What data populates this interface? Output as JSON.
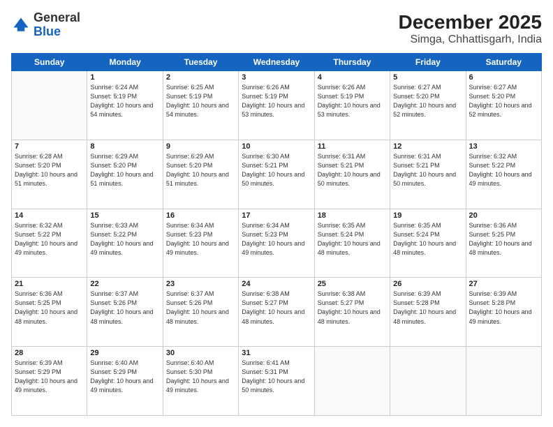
{
  "header": {
    "logo": {
      "general": "General",
      "blue": "Blue"
    },
    "title": "December 2025",
    "location": "Simga, Chhattisgarh, India"
  },
  "days_of_week": [
    "Sunday",
    "Monday",
    "Tuesday",
    "Wednesday",
    "Thursday",
    "Friday",
    "Saturday"
  ],
  "weeks": [
    [
      {
        "day": "",
        "empty": true
      },
      {
        "day": "1",
        "sunrise": "Sunrise: 6:24 AM",
        "sunset": "Sunset: 5:19 PM",
        "daylight": "Daylight: 10 hours and 54 minutes."
      },
      {
        "day": "2",
        "sunrise": "Sunrise: 6:25 AM",
        "sunset": "Sunset: 5:19 PM",
        "daylight": "Daylight: 10 hours and 54 minutes."
      },
      {
        "day": "3",
        "sunrise": "Sunrise: 6:26 AM",
        "sunset": "Sunset: 5:19 PM",
        "daylight": "Daylight: 10 hours and 53 minutes."
      },
      {
        "day": "4",
        "sunrise": "Sunrise: 6:26 AM",
        "sunset": "Sunset: 5:19 PM",
        "daylight": "Daylight: 10 hours and 53 minutes."
      },
      {
        "day": "5",
        "sunrise": "Sunrise: 6:27 AM",
        "sunset": "Sunset: 5:20 PM",
        "daylight": "Daylight: 10 hours and 52 minutes."
      },
      {
        "day": "6",
        "sunrise": "Sunrise: 6:27 AM",
        "sunset": "Sunset: 5:20 PM",
        "daylight": "Daylight: 10 hours and 52 minutes."
      }
    ],
    [
      {
        "day": "7",
        "sunrise": "Sunrise: 6:28 AM",
        "sunset": "Sunset: 5:20 PM",
        "daylight": "Daylight: 10 hours and 51 minutes."
      },
      {
        "day": "8",
        "sunrise": "Sunrise: 6:29 AM",
        "sunset": "Sunset: 5:20 PM",
        "daylight": "Daylight: 10 hours and 51 minutes."
      },
      {
        "day": "9",
        "sunrise": "Sunrise: 6:29 AM",
        "sunset": "Sunset: 5:20 PM",
        "daylight": "Daylight: 10 hours and 51 minutes."
      },
      {
        "day": "10",
        "sunrise": "Sunrise: 6:30 AM",
        "sunset": "Sunset: 5:21 PM",
        "daylight": "Daylight: 10 hours and 50 minutes."
      },
      {
        "day": "11",
        "sunrise": "Sunrise: 6:31 AM",
        "sunset": "Sunset: 5:21 PM",
        "daylight": "Daylight: 10 hours and 50 minutes."
      },
      {
        "day": "12",
        "sunrise": "Sunrise: 6:31 AM",
        "sunset": "Sunset: 5:21 PM",
        "daylight": "Daylight: 10 hours and 50 minutes."
      },
      {
        "day": "13",
        "sunrise": "Sunrise: 6:32 AM",
        "sunset": "Sunset: 5:22 PM",
        "daylight": "Daylight: 10 hours and 49 minutes."
      }
    ],
    [
      {
        "day": "14",
        "sunrise": "Sunrise: 6:32 AM",
        "sunset": "Sunset: 5:22 PM",
        "daylight": "Daylight: 10 hours and 49 minutes."
      },
      {
        "day": "15",
        "sunrise": "Sunrise: 6:33 AM",
        "sunset": "Sunset: 5:22 PM",
        "daylight": "Daylight: 10 hours and 49 minutes."
      },
      {
        "day": "16",
        "sunrise": "Sunrise: 6:34 AM",
        "sunset": "Sunset: 5:23 PM",
        "daylight": "Daylight: 10 hours and 49 minutes."
      },
      {
        "day": "17",
        "sunrise": "Sunrise: 6:34 AM",
        "sunset": "Sunset: 5:23 PM",
        "daylight": "Daylight: 10 hours and 49 minutes."
      },
      {
        "day": "18",
        "sunrise": "Sunrise: 6:35 AM",
        "sunset": "Sunset: 5:24 PM",
        "daylight": "Daylight: 10 hours and 48 minutes."
      },
      {
        "day": "19",
        "sunrise": "Sunrise: 6:35 AM",
        "sunset": "Sunset: 5:24 PM",
        "daylight": "Daylight: 10 hours and 48 minutes."
      },
      {
        "day": "20",
        "sunrise": "Sunrise: 6:36 AM",
        "sunset": "Sunset: 5:25 PM",
        "daylight": "Daylight: 10 hours and 48 minutes."
      }
    ],
    [
      {
        "day": "21",
        "sunrise": "Sunrise: 6:36 AM",
        "sunset": "Sunset: 5:25 PM",
        "daylight": "Daylight: 10 hours and 48 minutes."
      },
      {
        "day": "22",
        "sunrise": "Sunrise: 6:37 AM",
        "sunset": "Sunset: 5:26 PM",
        "daylight": "Daylight: 10 hours and 48 minutes."
      },
      {
        "day": "23",
        "sunrise": "Sunrise: 6:37 AM",
        "sunset": "Sunset: 5:26 PM",
        "daylight": "Daylight: 10 hours and 48 minutes."
      },
      {
        "day": "24",
        "sunrise": "Sunrise: 6:38 AM",
        "sunset": "Sunset: 5:27 PM",
        "daylight": "Daylight: 10 hours and 48 minutes."
      },
      {
        "day": "25",
        "sunrise": "Sunrise: 6:38 AM",
        "sunset": "Sunset: 5:27 PM",
        "daylight": "Daylight: 10 hours and 48 minutes."
      },
      {
        "day": "26",
        "sunrise": "Sunrise: 6:39 AM",
        "sunset": "Sunset: 5:28 PM",
        "daylight": "Daylight: 10 hours and 48 minutes."
      },
      {
        "day": "27",
        "sunrise": "Sunrise: 6:39 AM",
        "sunset": "Sunset: 5:28 PM",
        "daylight": "Daylight: 10 hours and 49 minutes."
      }
    ],
    [
      {
        "day": "28",
        "sunrise": "Sunrise: 6:39 AM",
        "sunset": "Sunset: 5:29 PM",
        "daylight": "Daylight: 10 hours and 49 minutes."
      },
      {
        "day": "29",
        "sunrise": "Sunrise: 6:40 AM",
        "sunset": "Sunset: 5:29 PM",
        "daylight": "Daylight: 10 hours and 49 minutes."
      },
      {
        "day": "30",
        "sunrise": "Sunrise: 6:40 AM",
        "sunset": "Sunset: 5:30 PM",
        "daylight": "Daylight: 10 hours and 49 minutes."
      },
      {
        "day": "31",
        "sunrise": "Sunrise: 6:41 AM",
        "sunset": "Sunset: 5:31 PM",
        "daylight": "Daylight: 10 hours and 50 minutes."
      },
      {
        "day": "",
        "empty": true
      },
      {
        "day": "",
        "empty": true
      },
      {
        "day": "",
        "empty": true
      }
    ]
  ]
}
